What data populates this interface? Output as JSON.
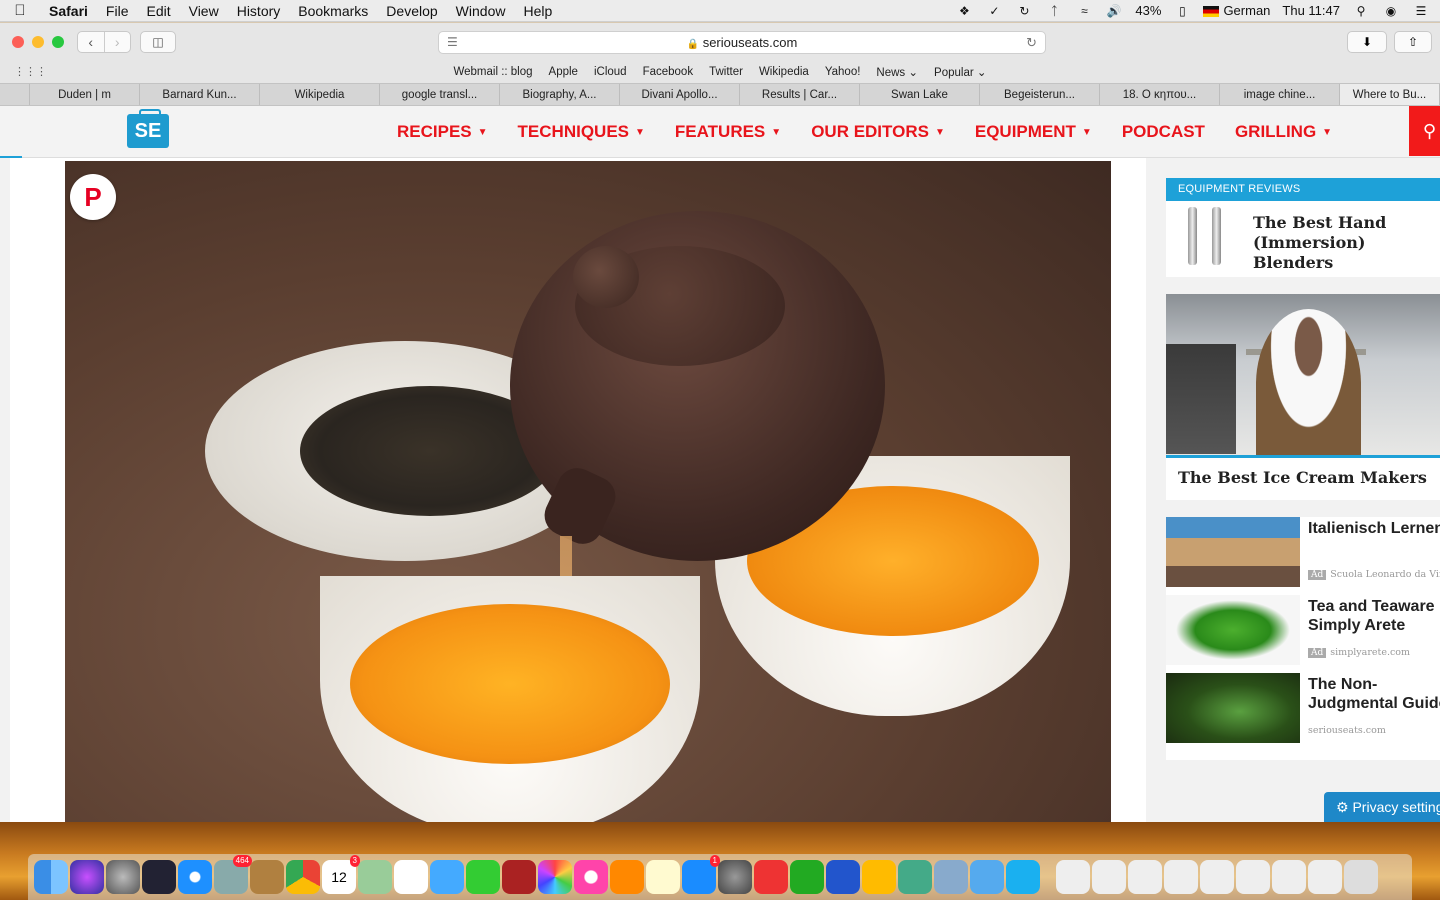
{
  "menubar": {
    "app": "Safari",
    "items": [
      "File",
      "Edit",
      "View",
      "History",
      "Bookmarks",
      "Develop",
      "Window",
      "Help"
    ],
    "battery": "43%",
    "input_source": "German",
    "clock": "Thu 11:47"
  },
  "toolbar": {
    "url": "seriouseats.com"
  },
  "bookmarks": [
    "Webmail :: blog",
    "Apple",
    "iCloud",
    "Facebook",
    "Twitter",
    "Wikipedia",
    "Yahoo!",
    "News",
    "Popular"
  ],
  "tabs": [
    "",
    "Duden | m",
    "Barnard Kun...",
    "Wikipedia",
    "google transl...",
    "Biography, A...",
    "Divani Apollo...",
    "Results | Car...",
    "Swan Lake",
    "Begeisterun...",
    "18. Ο κηπου...",
    "image chine...",
    "Where to Bu..."
  ],
  "site": {
    "logo": "SE",
    "nav": [
      {
        "label": "RECIPES",
        "caret": "▼"
      },
      {
        "label": "TECHNIQUES",
        "caret": "▼"
      },
      {
        "label": "FEATURES",
        "caret": "▼"
      },
      {
        "label": "OUR EDITORS",
        "caret": "▼"
      },
      {
        "label": "EQUIPMENT",
        "caret": "▼"
      },
      {
        "label": "PODCAST",
        "caret": ""
      },
      {
        "label": "GRILLING",
        "caret": "▼"
      }
    ]
  },
  "sidebar": {
    "equipment_header": "EQUIPMENT REVIEWS",
    "equipment_title": "The Best Hand (Immersion) Blenders",
    "video_title": "The Best Ice Cream Makers",
    "ads": [
      {
        "title": "Italienisch Lernen",
        "title2": "",
        "source": "Scuola Leonardo da Vinci"
      },
      {
        "title": "Tea and Teaware",
        "title2": "Simply Arete",
        "source": "simplyarete.com"
      },
      {
        "title": "The Non-",
        "title2": "Judgmental Guide",
        "source": "seriouseats.com"
      }
    ],
    "ad_tag": "Ad",
    "privacy": "Privacy settings"
  },
  "dock": {
    "badges": {
      "mail": "464",
      "calendar": "3",
      "appstore": "1"
    },
    "calendar_day": "12"
  }
}
